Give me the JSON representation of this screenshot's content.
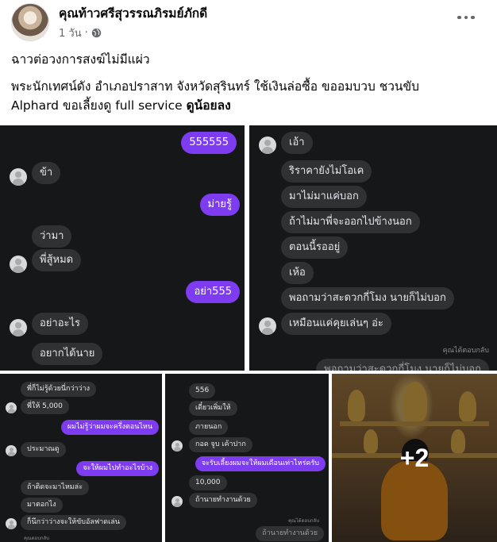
{
  "post": {
    "author": "คุณท้าวศรีสุวรรณภิรมย์ภักดี",
    "time": "1 วัน",
    "separator": "·",
    "privacy_icon": "globe-icon",
    "more_icon": "more-horizontal-icon",
    "caption_line1": "ฉาวต่อวงการสงฆ์ไม่มีแผ่ว",
    "caption_line2": "พระนักเทศน์ดัง อำเภอปราสาท จังหวัดสุรินทร์ ใช้เงินล่อซื้อ ขออมบวบ ชวนขับ",
    "caption_line3a": "Alphard ขอเลี้ยงดู full service ",
    "caption_line3b": "ดูน้อยลง"
  },
  "gallery": {
    "more_count": "+2",
    "panel1": {
      "messages": [
        "555555",
        "ข้า",
        "ม่ายรู้",
        "ว่ามา",
        "พี่สู้หมด",
        "อย่า555",
        "อย่าอะไร",
        "อยากได้นาย"
      ]
    },
    "panel2": {
      "messages": [
        "เอ้า",
        "ริราคายังไม่โอเค",
        "มาไม่มาแค่บอก",
        "ถ้าไม่มาพี่จะออกไปข้างนอก",
        "ตอนนี้รออยู่",
        "เห้อ",
        "พอถามว่าสะดวกกี่โมง นายก็ไม่บอก",
        "เหมือนแค่คุยเล่นๆ อ่ะ"
      ],
      "reply_note": "คุณได้ตอบกลับ",
      "reply_preview": "พอถามว่าสะดวกกี่โมง นายก็ไม่บอก"
    },
    "panel3": {
      "messages": [
        "พี่ก็ไม่รู้ด้วยนี่กว่าว่าง",
        "พี่ให้ 5,000",
        "ผมไม่รู้ว่าผมจะครึ่งตอนไหน",
        "ประมาณดู",
        "จะให้ผมไปทำอะไรบ้าง",
        "ถ้าติดจะมาไหมล่ะ",
        "มาตอกไง",
        "ก็นึกว่าว่างจะให้ขับอัลฟาดเล่น"
      ],
      "reply_note": "คุณตอบกลับ"
    },
    "panel4": {
      "messages": [
        "556",
        "เดี๋ยวเพิ่มให้",
        "ภายนอก",
        "กอด จูบ เค้าปาก",
        "จะรับเลี้ยงผมจะให้ผมเดือนเท่าไหร่ครับ",
        "10,000",
        "ถ้านายทำงานด้วย"
      ],
      "reply_note": "คุณได้ตอบกลับ",
      "reply_preview": "ถ้านายทำงานด้วย"
    }
  },
  "colors": {
    "my_bubble": "#7d3cf0",
    "their_bubble": "#303133",
    "chat_bg": "#161719",
    "meta_text": "#65676b"
  }
}
